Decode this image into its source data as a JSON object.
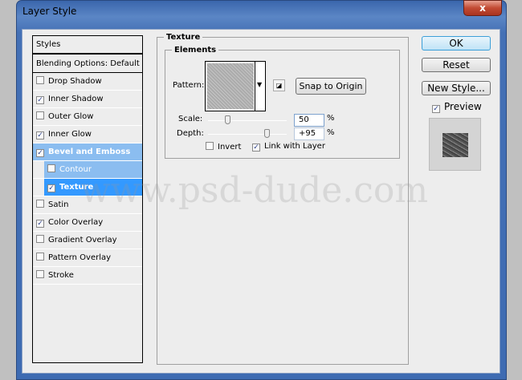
{
  "window": {
    "title": "Layer Style",
    "close": "x"
  },
  "styles_list": {
    "header": "Styles",
    "blending": "Blending Options: Default",
    "items": [
      {
        "label": "Drop Shadow",
        "checked": false
      },
      {
        "label": "Inner Shadow",
        "checked": true
      },
      {
        "label": "Outer Glow",
        "checked": false
      },
      {
        "label": "Inner Glow",
        "checked": true
      },
      {
        "label": "Bevel and Emboss",
        "checked": true
      },
      {
        "label": "Contour",
        "checked": false
      },
      {
        "label": "Texture",
        "checked": true
      },
      {
        "label": "Satin",
        "checked": false
      },
      {
        "label": "Color Overlay",
        "checked": true
      },
      {
        "label": "Gradient Overlay",
        "checked": false
      },
      {
        "label": "Pattern Overlay",
        "checked": false
      },
      {
        "label": "Stroke",
        "checked": false
      }
    ]
  },
  "texture": {
    "title": "Texture",
    "elements_title": "Elements",
    "pattern_label": "Pattern:",
    "snap_button": "Snap to Origin",
    "scale_label": "Scale:",
    "scale_value": "50",
    "scale_unit": "%",
    "depth_label": "Depth:",
    "depth_value": "+95",
    "depth_unit": "%",
    "invert_label": "Invert",
    "invert_checked": false,
    "link_label": "Link with Layer",
    "link_checked": true
  },
  "buttons": {
    "ok": "OK",
    "reset": "Reset",
    "new_style": "New Style..."
  },
  "preview": {
    "label": "Preview",
    "checked": true
  },
  "watermark": "www.psd-dude.com"
}
